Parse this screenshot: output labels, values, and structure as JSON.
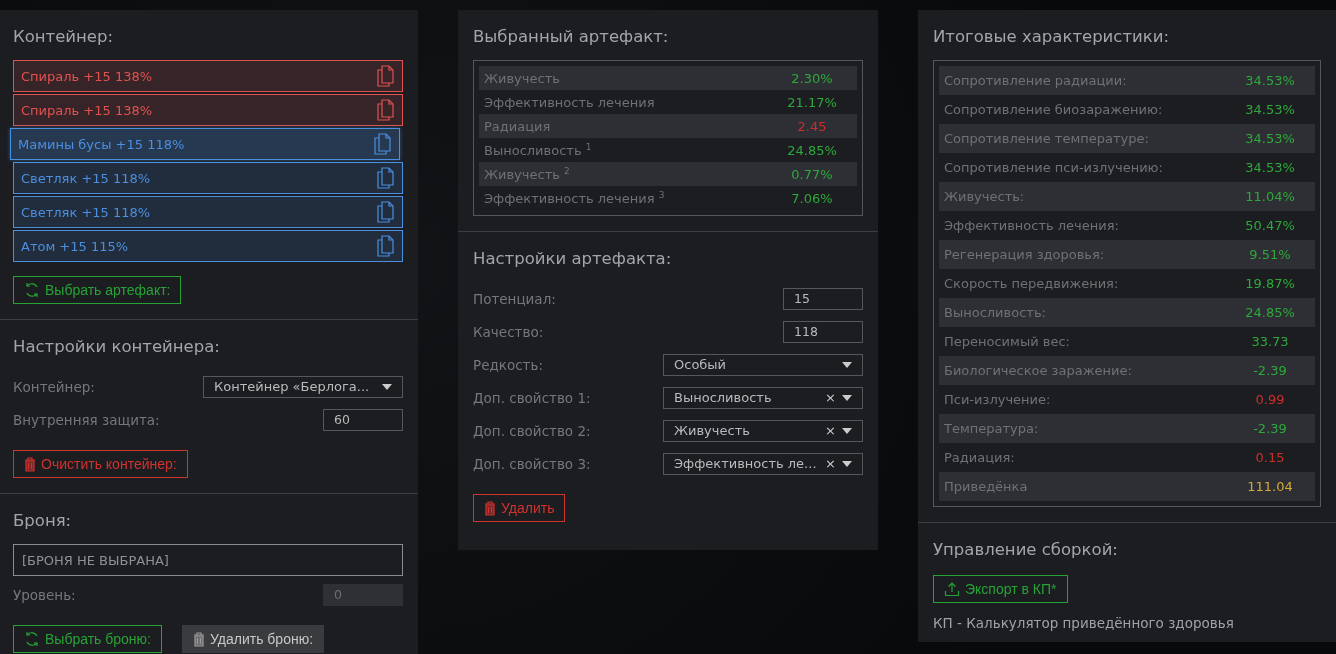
{
  "container": {
    "title": "Контейнер:",
    "artifacts": [
      {
        "label": "Спираль +15 138%",
        "color": "#e0524f",
        "selected": false
      },
      {
        "label": "Спираль +15 138%",
        "color": "#e0524f",
        "selected": false
      },
      {
        "label": "Мамины бусы +15 118%",
        "color": "#4a8fe0",
        "selected": true
      },
      {
        "label": "Светляк +15 118%",
        "color": "#4a8fe0",
        "selected": false
      },
      {
        "label": "Светляк +15 118%",
        "color": "#4a8fe0",
        "selected": false
      },
      {
        "label": "Атом +15 115%",
        "color": "#4a8fe0",
        "selected": false
      }
    ],
    "pick_button": "Выбрать артефакт:"
  },
  "container_settings": {
    "title": "Настройки контейнера:",
    "rows": [
      {
        "kind": "select",
        "label": "Контейнер:",
        "value": "Контейнер «Берлога..."
      },
      {
        "kind": "input",
        "label": "Внутренняя защита:",
        "value": "60"
      }
    ],
    "clear_button": "Очистить контейнер:"
  },
  "armor": {
    "title": "Броня:",
    "field": "[БРОНЯ НЕ ВЫБРАНА]",
    "level_label": "Уровень:",
    "level_value": "0",
    "level_disabled": true,
    "pick_button": "Выбрать броню:",
    "remove_button": "Удалить броню:"
  },
  "selected_artifact": {
    "title": "Выбранный артефакт:",
    "stats": [
      {
        "name": "Живучесть",
        "value": "2.30%",
        "color": "#2fa83a"
      },
      {
        "name": "Эффективность лечения",
        "value": "21.17%",
        "color": "#2fa83a"
      },
      {
        "name": "Радиация",
        "value": "2.45",
        "color": "#c9302c"
      },
      {
        "name": "Выносливость $^{1}$",
        "value": "24.85%",
        "color": "#2fa83a"
      },
      {
        "name": "Живучесть $^{2}$",
        "value": "0.77%",
        "color": "#2fa83a"
      },
      {
        "name": "Эффективность лечения $^{3}$",
        "value": "7.06%",
        "color": "#2fa83a"
      }
    ]
  },
  "artifact_settings": {
    "title": "Настройки артефакта:",
    "rows": [
      {
        "kind": "input",
        "label": "Потенциал:",
        "value": "15"
      },
      {
        "kind": "input",
        "label": "Качество:",
        "value": "118"
      },
      {
        "kind": "select",
        "label": "Редкость:",
        "value": "Особый"
      },
      {
        "kind": "select",
        "label": "Доп. свойство 1:",
        "value": "Выносливость",
        "clear": "×"
      },
      {
        "kind": "select",
        "label": "Доп. свойство 2:",
        "value": "Живучесть",
        "clear": "×"
      },
      {
        "kind": "select",
        "label": "Доп. свойство 3:",
        "value": "Эффективность ле...",
        "clear": "×"
      }
    ],
    "delete_button": "Удалить"
  },
  "totals": {
    "title": "Итоговые характеристики:",
    "stats": [
      {
        "name": "Сопротивление радиации:",
        "value": "34.53%",
        "color": "#2fa83a"
      },
      {
        "name": "Сопротивление биозаражению:",
        "value": "34.53%",
        "color": "#2fa83a"
      },
      {
        "name": "Сопротивление температуре:",
        "value": "34.53%",
        "color": "#2fa83a"
      },
      {
        "name": "Сопротивление пси-излучению:",
        "value": "34.53%",
        "color": "#2fa83a"
      },
      {
        "name": "Живучесть:",
        "value": "11.04%",
        "color": "#2fa83a"
      },
      {
        "name": "Эффективность лечения:",
        "value": "50.47%",
        "color": "#2fa83a"
      },
      {
        "name": "Регенерация здоровья:",
        "value": "9.51%",
        "color": "#2fa83a"
      },
      {
        "name": "Скорость передвижения:",
        "value": "19.87%",
        "color": "#2fa83a"
      },
      {
        "name": "Выносливость:",
        "value": "24.85%",
        "color": "#2fa83a"
      },
      {
        "name": "Переносимый вес:",
        "value": "33.73",
        "color": "#2fa83a"
      },
      {
        "name": "Биологическое заражение:",
        "value": "-2.39",
        "color": "#2fa83a"
      },
      {
        "name": "Пси-излучение:",
        "value": "0.99",
        "color": "#c9302c"
      },
      {
        "name": "Температура:",
        "value": "-2.39",
        "color": "#2fa83a"
      },
      {
        "name": "Радиация:",
        "value": "0.15",
        "color": "#c9302c"
      },
      {
        "name": "Приведёнка",
        "value": "111.04",
        "color": "#d4a936"
      }
    ]
  },
  "build": {
    "title": "Управление сборкой:",
    "export_button": "Экспорт в КП*",
    "note": "КП - Калькулятор приведённого здоровья"
  }
}
